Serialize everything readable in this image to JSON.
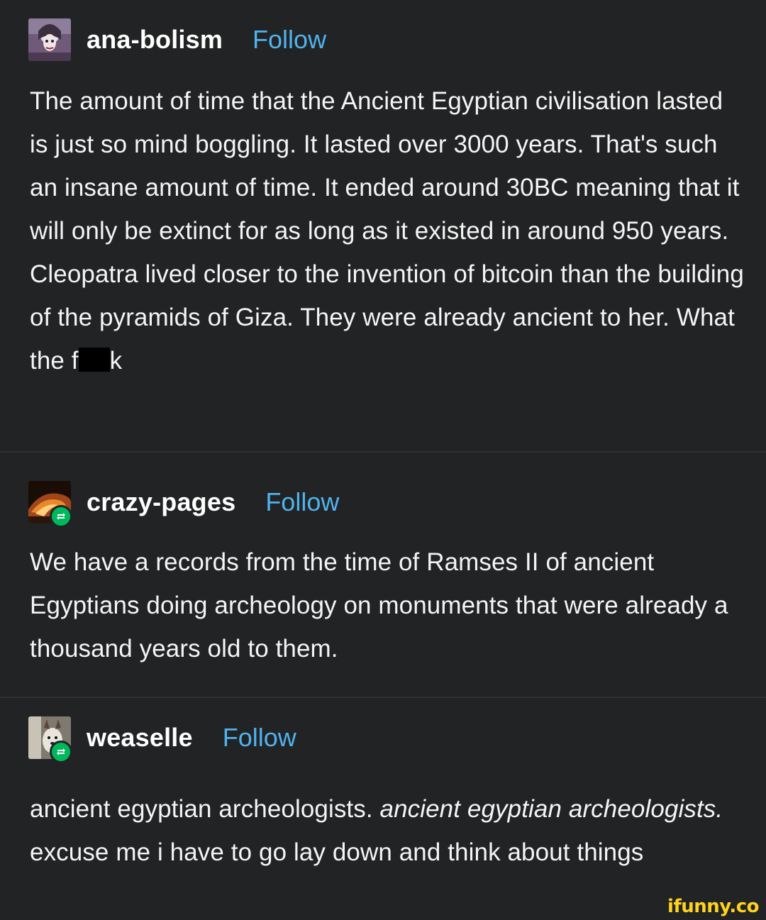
{
  "posts": [
    {
      "username": "ana-bolism",
      "follow_label": "Follow",
      "avatar": "profile-photo",
      "reblog": false,
      "text": "The amount of time that the Ancient Egyptian civilisation lasted is just so mind boggling. It lasted over 3000 years. That's such an insane amount of time. It ended around 30BC meaning that it will only be extinct for as long as it existed in around 950 years. Cleopatra lived closer to the invention of bitcoin than the building of the pyramids of Giza. They were already ancient to her. What the f",
      "text_end": "k"
    },
    {
      "username": "crazy-pages",
      "follow_label": "Follow",
      "avatar": "fire-photo",
      "reblog": true,
      "text": "We have a records from the time of Ramses II of ancient Egyptians doing archeology on monuments that were already a thousand years old to them."
    },
    {
      "username": "weaselle",
      "follow_label": "Follow",
      "avatar": "dog-photo",
      "reblog": true,
      "text_a": "ancient egyptian archeologists. ",
      "text_italic": "ancient egyptian archeologists.",
      "text_b": " excuse me i have to go lay down and think about things"
    }
  ],
  "icons": {
    "reblog": "reblog-icon"
  },
  "watermark": "ifunny.co",
  "colors": {
    "background": "#222324",
    "follow": "#4fb3ee",
    "reblog_badge": "#00b85c",
    "watermark": "#ffd21f"
  }
}
